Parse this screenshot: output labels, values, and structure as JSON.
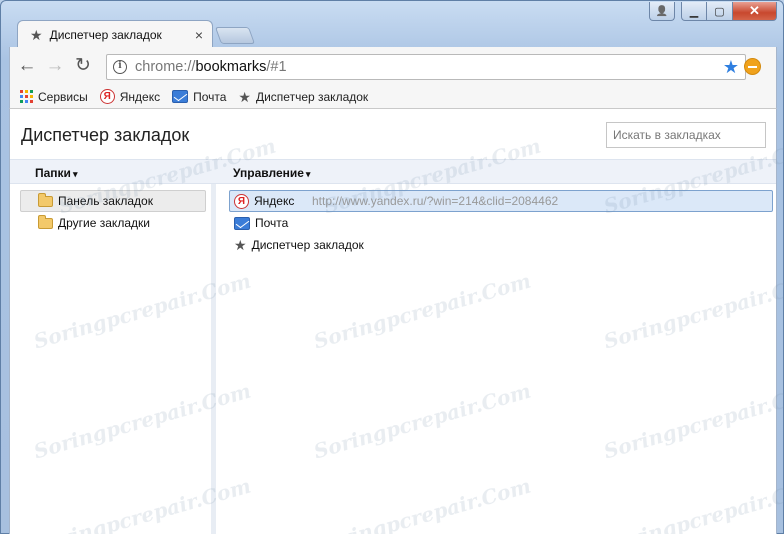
{
  "window": {
    "controls": {
      "minimize": "▁",
      "maximize": "▢",
      "close": "✕",
      "profile": "👤"
    }
  },
  "tab": {
    "title": "Диспетчер закладок",
    "close": "×",
    "icon": "star-icon"
  },
  "toolbar": {
    "back": "←",
    "forward": "→",
    "reload": "↻",
    "url_scheme": "chrome://",
    "url_host": "bookmarks",
    "url_path": "/#1",
    "star": "★"
  },
  "bookmarks_bar": {
    "items": [
      {
        "label": "Сервисы",
        "icon": "apps-icon"
      },
      {
        "label": "Яндекс",
        "icon": "yandex-icon"
      },
      {
        "label": "Почта",
        "icon": "mail-icon"
      },
      {
        "label": "Диспетчер закладок",
        "icon": "star-icon"
      }
    ]
  },
  "page": {
    "title": "Диспетчер закладок",
    "search_placeholder": "Искать в закладках",
    "folders_header": "Папки",
    "manage_header": "Управление",
    "caret": "▾"
  },
  "folders": [
    {
      "label": "Панель закладок",
      "selected": true
    },
    {
      "label": "Другие закладки",
      "selected": false
    }
  ],
  "bookmarks": [
    {
      "name": "Яндекс",
      "url": "http://www.yandex.ru/?win=214&clid=2084462",
      "icon": "yandex-icon",
      "selected": true
    },
    {
      "name": "Почта",
      "url": "",
      "icon": "mail-icon",
      "selected": false
    },
    {
      "name": "Диспетчер закладок",
      "url": "",
      "icon": "star-icon",
      "selected": false
    }
  ],
  "watermark": "Soringpcrepair.Com",
  "colors": {
    "accent_star": "#2f7fe0",
    "selection": "#dbe8f8",
    "close_button": "#c8482e"
  }
}
